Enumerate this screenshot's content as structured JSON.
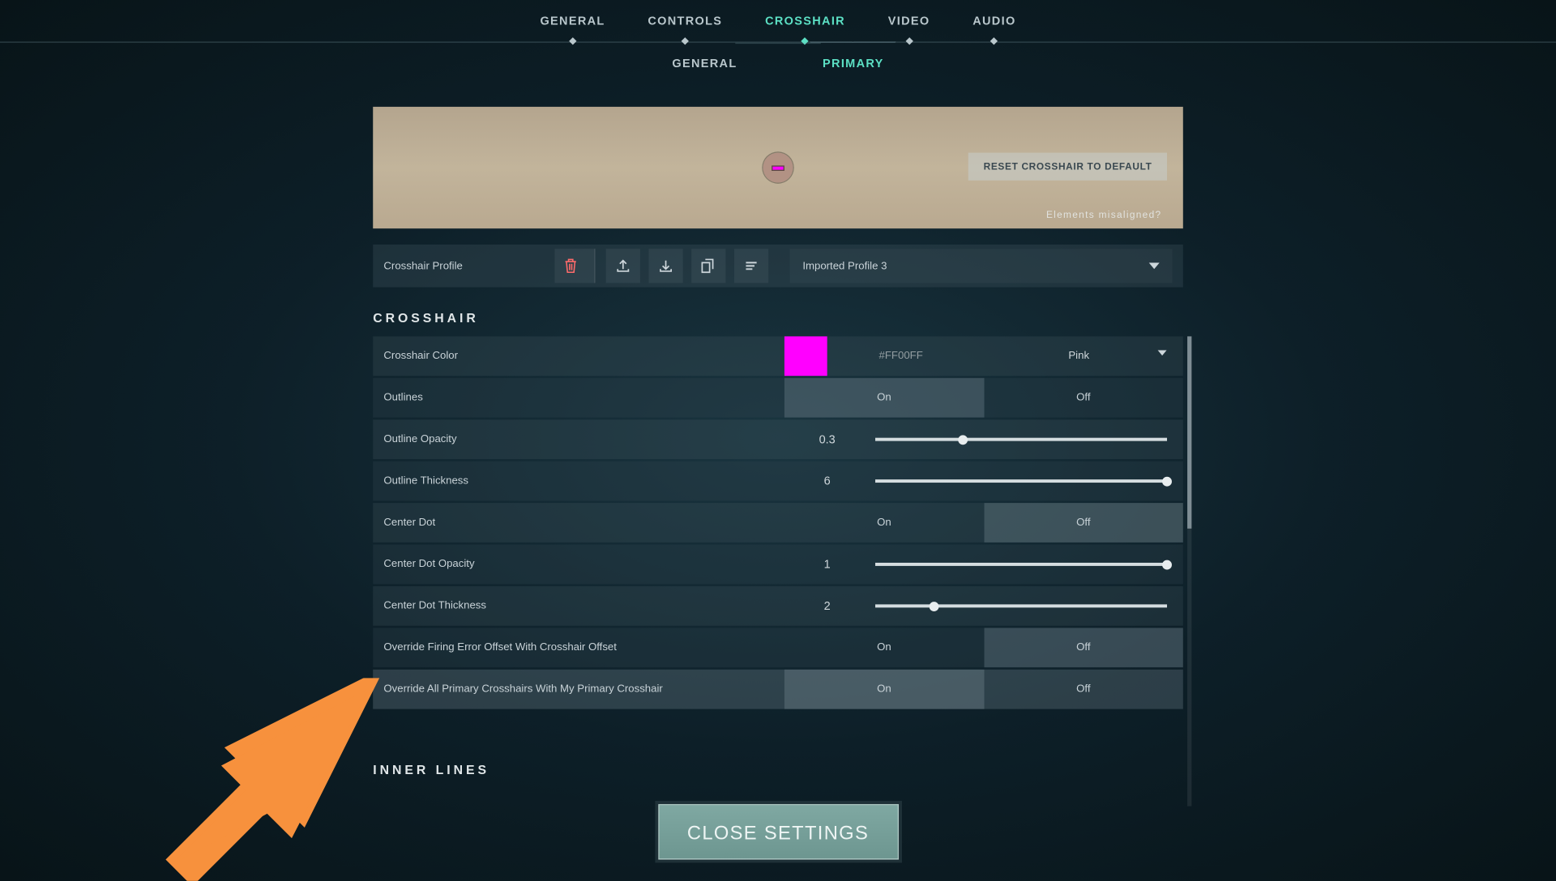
{
  "topNav": [
    "GENERAL",
    "CONTROLS",
    "CROSSHAIR",
    "VIDEO",
    "AUDIO"
  ],
  "topNavActive": "CROSSHAIR",
  "subNav": [
    "GENERAL",
    "PRIMARY"
  ],
  "subNavActive": "PRIMARY",
  "preview": {
    "resetLabel": "RESET CROSSHAIR TO DEFAULT",
    "misalignedLabel": "Elements misaligned?"
  },
  "profile": {
    "label": "Crosshair Profile",
    "selected": "Imported Profile 3"
  },
  "section1": "CROSSHAIR",
  "section2": "INNER LINES",
  "color": {
    "label": "Crosshair Color",
    "hex": "#FF00FF",
    "name": "Pink"
  },
  "rows": {
    "outlines": {
      "label": "Outlines",
      "value": "On",
      "options": [
        "On",
        "Off"
      ]
    },
    "outlineOpacity": {
      "label": "Outline Opacity",
      "value": "0.3",
      "sliderPos": 0.3
    },
    "outlineThickness": {
      "label": "Outline Thickness",
      "value": "6",
      "sliderPos": 1.0
    },
    "centerDot": {
      "label": "Center Dot",
      "value": "Off",
      "options": [
        "On",
        "Off"
      ]
    },
    "centerDotOpacity": {
      "label": "Center Dot Opacity",
      "value": "1",
      "sliderPos": 1.0
    },
    "centerDotThickness": {
      "label": "Center Dot Thickness",
      "value": "2",
      "sliderPos": 0.2
    },
    "overrideFiring": {
      "label": "Override Firing Error Offset With Crosshair Offset",
      "value": "Off",
      "options": [
        "On",
        "Off"
      ]
    },
    "overrideAll": {
      "label": "Override All Primary Crosshairs With My Primary Crosshair",
      "value": "On",
      "options": [
        "On",
        "Off"
      ]
    }
  },
  "toggleLabels": {
    "on": "On",
    "off": "Off"
  },
  "closeLabel": "CLOSE SETTINGS"
}
